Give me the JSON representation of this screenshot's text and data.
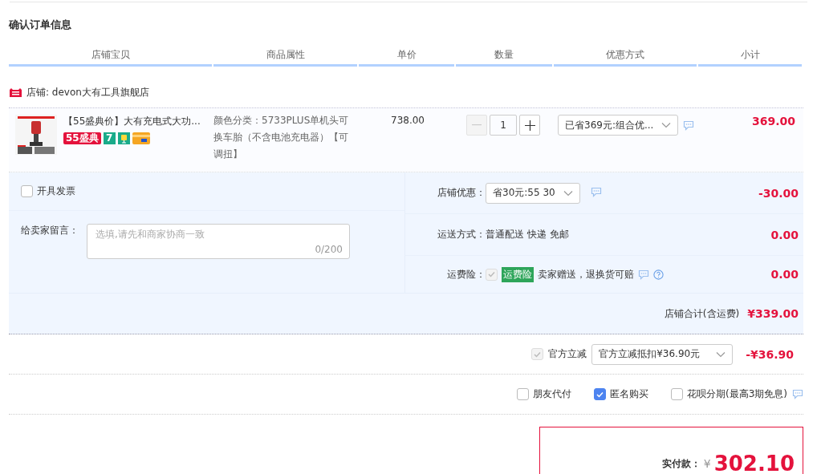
{
  "section_title": "确认订单信息",
  "columns": [
    "店铺宝贝",
    "商品属性",
    "单价",
    "数量",
    "优惠方式",
    "小计"
  ],
  "store": {
    "label": "店铺: devon大有工具旗舰店"
  },
  "item": {
    "title": "【55盛典价】大有充电式大功...",
    "promo_tag": "55盛典",
    "day_tag": "7",
    "attributes": "颜色分类：5733PLUS单机头可换车胎（不含电池充电器）【可调扭】",
    "price": "738.00",
    "quantity": "1",
    "discount": "已省369元:组合优...",
    "subtotal": "369.00"
  },
  "invoice": {
    "label": "开具发票",
    "checked": false
  },
  "message": {
    "label": "给卖家留言：",
    "placeholder": "选填,请先和商家协商一致",
    "counter": "0/200"
  },
  "store_rows": [
    {
      "kind": "select",
      "label": "店铺优惠：",
      "value": "省30元:55 30",
      "amount": "-30.00"
    },
    {
      "kind": "text",
      "label": "运送方式：",
      "value": "普通配送 快递 免邮",
      "amount": "0.00"
    },
    {
      "kind": "insurance",
      "label": "运费险：",
      "checked": true,
      "disabled": true,
      "tag": "运费险",
      "value": "卖家赠送，退换货可赔",
      "amount": "0.00"
    }
  ],
  "store_total": {
    "label": "店铺合计(含运费)",
    "amount": "¥339.00"
  },
  "official": {
    "label": "官方立减",
    "checked": true,
    "disabled": true,
    "select": "官方立减抵扣¥36.90元",
    "amount": "-¥36.90"
  },
  "options": [
    {
      "label": "朋友代付",
      "checked": false
    },
    {
      "label": "匿名购买",
      "checked": true
    },
    {
      "label": "花呗分期(最高3期免息)",
      "checked": false
    }
  ],
  "payment": {
    "label": "实付款：",
    "currency": "¥",
    "amount": "302.10"
  }
}
